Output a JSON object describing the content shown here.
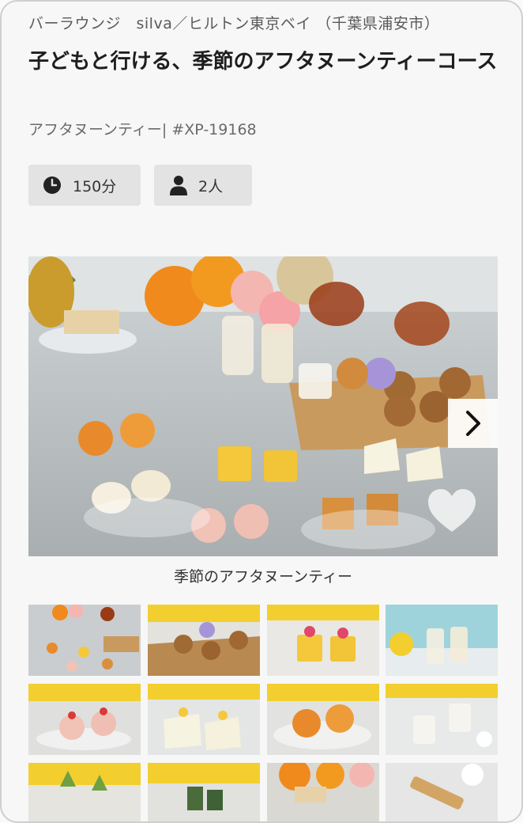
{
  "venue": "バーラウンジ　silva／ヒルトン東京ベイ （千葉県浦安市）",
  "title": "子どもと行ける、季節のアフタヌーンティーコース",
  "category": "アフタヌーンティー| #XP-19168",
  "duration": {
    "icon": "clock-icon",
    "label": "150分"
  },
  "guests": {
    "icon": "person-icon",
    "label": "2人"
  },
  "gallery": {
    "caption": "季節のアフタヌーンティー",
    "next_icon": "chevron-right-icon",
    "favorite_icon": "heart-icon"
  },
  "colors": {
    "pill_bg": "#e3e3e3",
    "text_dark": "#1e1e1e",
    "text_muted": "#6a6a6a",
    "card_bg": "#f7f7f7",
    "card_border": "#cfcfcf"
  }
}
